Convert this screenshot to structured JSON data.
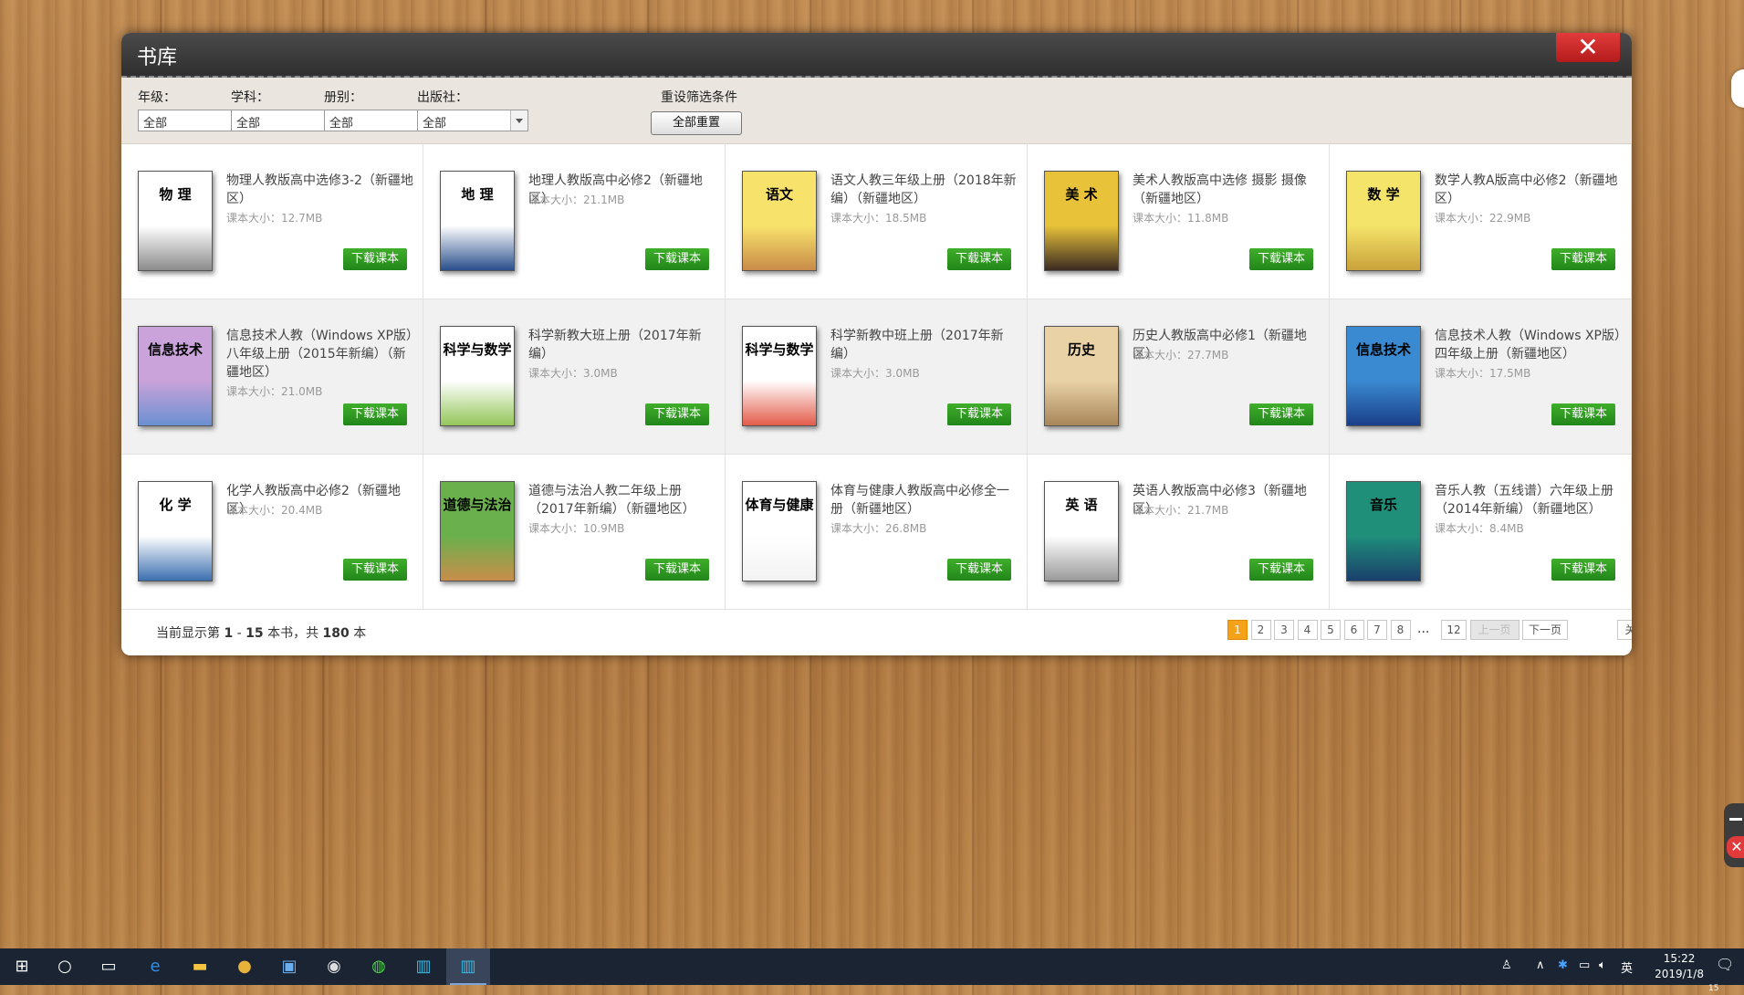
{
  "window": {
    "title": "书库",
    "close_glyph": "✕"
  },
  "filters": [
    {
      "label": "年级：",
      "value": "全部"
    },
    {
      "label": "学科：",
      "value": "全部"
    },
    {
      "label": "册别：",
      "value": "全部"
    },
    {
      "label": "出版社：",
      "value": "全部"
    }
  ],
  "reset": {
    "label": "重设筛选条件",
    "button": "全部重置"
  },
  "size_prefix": "课本大小：",
  "download_label": "下载课本",
  "books": [
    {
      "name": "物理人教版高中选修3-2（新疆地区）",
      "size": "12.7MB",
      "cover_title": "物 理",
      "cover_color": "#ffffff",
      "cover_bottom": "#8c8c8c"
    },
    {
      "name": "地理人教版高中必修2（新疆地区）",
      "size": "21.1MB",
      "cover_title": "地 理",
      "cover_color": "#ffffff",
      "cover_bottom": "#2a4f8c"
    },
    {
      "name": "语文人教三年级上册（2018年新编）（新疆地区）",
      "size": "18.5MB",
      "cover_title": "语文",
      "cover_color": "#f7e36b",
      "cover_bottom": "#c98b49"
    },
    {
      "name": "美术人教版高中选修 摄影 摄像（新疆地区）",
      "size": "11.8MB",
      "cover_title": "美 术",
      "cover_color": "#e8c33a",
      "cover_bottom": "#3b2b22"
    },
    {
      "name": "数学人教A版高中必修2（新疆地区）",
      "size": "22.9MB",
      "cover_title": "数 学",
      "cover_color": "#f4e46a",
      "cover_bottom": "#c9a23b"
    },
    {
      "name": "信息技术人教（Windows XP版）八年级上册（2015年新编）（新疆地区）",
      "size": "21.0MB",
      "cover_title": "信息技术",
      "cover_color": "#c9a3d9",
      "cover_bottom": "#6b8fd1"
    },
    {
      "name": "科学新教大班上册（2017年新编）",
      "size": "3.0MB",
      "cover_title": "科学与数学",
      "cover_color": "#ffffff",
      "cover_bottom": "#93c659"
    },
    {
      "name": "科学新教中班上册（2017年新编）",
      "size": "3.0MB",
      "cover_title": "科学与数学",
      "cover_color": "#ffffff",
      "cover_bottom": "#e35b4a"
    },
    {
      "name": "历史人教版高中必修1（新疆地区）",
      "size": "27.7MB",
      "cover_title": "历史",
      "cover_color": "#e9d2a6",
      "cover_bottom": "#a8865a"
    },
    {
      "name": "信息技术人教（Windows XP版）四年级上册（新疆地区）",
      "size": "17.5MB",
      "cover_title": "信息技术",
      "cover_color": "#3a8ad1",
      "cover_bottom": "#1b3f8a"
    },
    {
      "name": "化学人教版高中必修2（新疆地区）",
      "size": "20.4MB",
      "cover_title": "化 学",
      "cover_color": "#ffffff",
      "cover_bottom": "#3c6fb0"
    },
    {
      "name": "道德与法治人教二年级上册（2017年新编）（新疆地区）",
      "size": "10.9MB",
      "cover_title": "道德与法治",
      "cover_color": "#6ab04c",
      "cover_bottom": "#c98d4b"
    },
    {
      "name": "体育与健康人教版高中必修全一册（新疆地区）",
      "size": "26.8MB",
      "cover_title": "体育与健康",
      "cover_color": "#ffffff",
      "cover_bottom": "#f2f2f2"
    },
    {
      "name": "英语人教版高中必修3（新疆地区）",
      "size": "21.7MB",
      "cover_title": "英 语",
      "cover_color": "#ffffff",
      "cover_bottom": "#9a9a9a"
    },
    {
      "name": "音乐人教（五线谱）六年级上册（2014年新编）（新疆地区）",
      "size": "8.4MB",
      "cover_title": "音乐",
      "cover_color": "#1f8f7a",
      "cover_bottom": "#1a3f6b"
    }
  ],
  "footer": {
    "status_prefix": "当前显示第 ",
    "range_start": "1",
    "range_sep": " - ",
    "range_end": "15",
    "status_mid": " 本书，共 ",
    "total": "180",
    "status_suffix": " 本",
    "pages": [
      "1",
      "2",
      "3",
      "4",
      "5",
      "6",
      "7",
      "8"
    ],
    "ellipsis": "...",
    "last_page": "12",
    "prev": "上一页",
    "next": "下一页",
    "close": "关闭书库"
  },
  "taskbar": {
    "time": "15:22",
    "date": "2019/1/8",
    "ime": "英",
    "notif_count": "15"
  }
}
